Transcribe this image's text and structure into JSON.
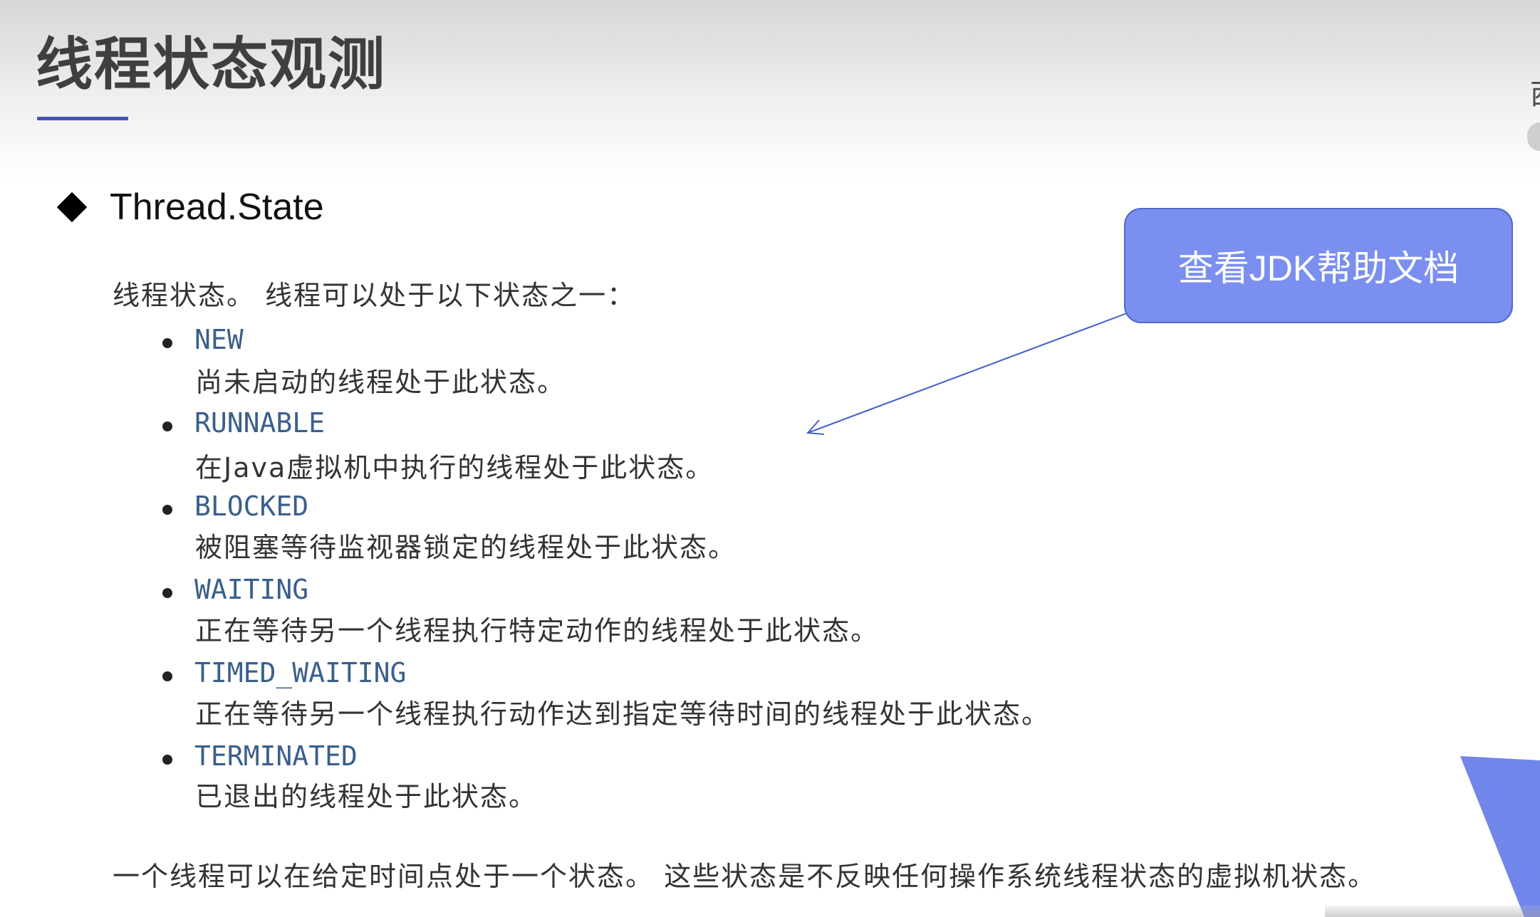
{
  "slide": {
    "title": "线程状态观测",
    "heading": "Thread.State",
    "intro": "线程状态。 线程可以处于以下状态之一：",
    "states": [
      {
        "name": "NEW",
        "desc": "尚未启动的线程处于此状态。"
      },
      {
        "name": "RUNNABLE",
        "desc": "在Java虚拟机中执行的线程处于此状态。"
      },
      {
        "name": "BLOCKED",
        "desc": "被阻塞等待监视器锁定的线程处于此状态。"
      },
      {
        "name": "WAITING",
        "desc": "正在等待另一个线程执行特定动作的线程处于此状态。"
      },
      {
        "name": "TIMED_WAITING",
        "desc": "正在等待另一个线程执行动作达到指定等待时间的线程处于此状态。"
      },
      {
        "name": "TERMINATED",
        "desc": "已退出的线程处于此状态。"
      }
    ],
    "footer": "一个线程可以在给定时间点处于一个状态。 这些状态是不反映任何操作系统线程状态的虚拟机状态。"
  },
  "callout": {
    "label": "查看JDK帮助文档"
  },
  "edge": {
    "glyph": "西"
  },
  "colors": {
    "title": "#3f3f3f",
    "title_underline": "#3f55b5",
    "state_name": "#3a5f8c",
    "callout_fill": "#7a8ff0",
    "callout_arrow": "#4a5fc8",
    "corner_shape": "#7086ea"
  }
}
